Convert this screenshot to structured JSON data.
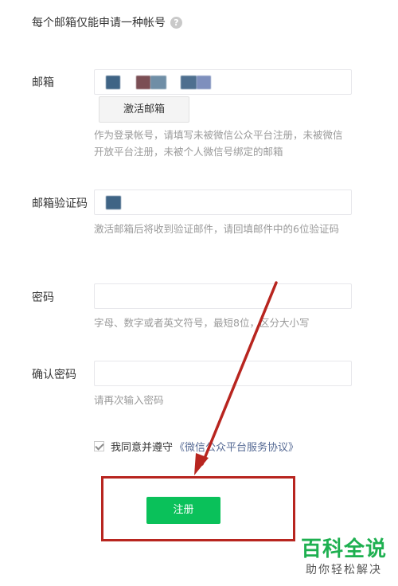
{
  "notice": {
    "text": "每个邮箱仅能申请一种帐号",
    "help_icon": "?"
  },
  "email": {
    "label": "邮箱",
    "activate_button": "激活邮箱",
    "hint": "作为登录帐号，请填写未被微信公众平台注册，未被微信开放平台注册，未被个人微信号绑定的邮箱"
  },
  "verify_code": {
    "label": "邮箱验证码",
    "hint": "激活邮箱后将收到验证邮件，请回填邮件中的6位验证码"
  },
  "password": {
    "label": "密码",
    "hint": "字母、数字或者英文符号，最短8位，区分大小写"
  },
  "confirm_password": {
    "label": "确认密码",
    "hint": "请再次输入密码"
  },
  "agreement": {
    "text": "我同意并遵守",
    "link": "《微信公众平台服务协议》",
    "checked": true
  },
  "register_button": "注册",
  "watermark": {
    "main": "百科全说",
    "sub": "助你轻松解决"
  },
  "colors": {
    "accent_green": "#0ac15a",
    "annotation_red": "#b8251f",
    "link_blue": "#576b95"
  }
}
